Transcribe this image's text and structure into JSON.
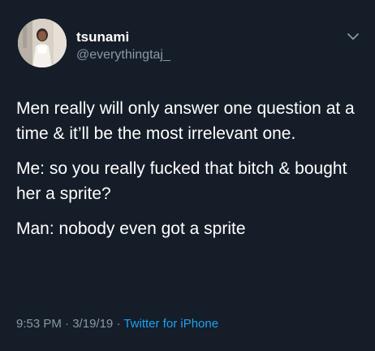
{
  "tweet": {
    "display_name": "tsunami",
    "handle": "@everythingtaj_",
    "paragraphs": [
      "Men really will only answer one question at a time & it’ll be the most irrelevant one.",
      "Me: so you really fucked that bitch & bought her a sprite?",
      "Man: nobody even got a sprite"
    ],
    "time": "9:53 PM",
    "separator": "·",
    "date": "3/19/19",
    "source": "Twitter for iPhone"
  },
  "icons": {
    "avatar": "profile-photo",
    "menu": "chevron-down-icon"
  },
  "colors": {
    "background": "#151d28",
    "text": "#ffffff",
    "secondary_text": "#8899a6",
    "link": "#1da1f2"
  }
}
